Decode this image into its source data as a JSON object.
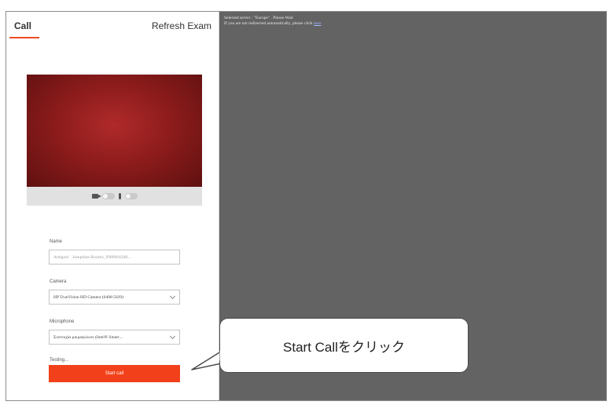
{
  "panel": {
    "tab_call": "Call",
    "refresh_exam": "Refresh Exam",
    "fields": {
      "name_label": "Name",
      "name_value": "Antigoni · Josephine.Rosotis_9980964248...",
      "camera_label": "Camera",
      "camera_value": "HP TrueVision HD Camera (0408:5029)",
      "microphone_label": "Microphone",
      "microphone_value": "Συστοιχία μικροφώνων (Intel® Smart...",
      "testing_label": "Testing..."
    },
    "start_button": "Start call"
  },
  "content": {
    "line1": "Selected server : \"Europe\" . Please Wait",
    "line2": "If you are not redirected automatically, please click",
    "link": "here"
  },
  "callout": {
    "text": "Start Callをクリック"
  },
  "colors": {
    "accent": "#f2411a",
    "content_bg": "#636363"
  }
}
